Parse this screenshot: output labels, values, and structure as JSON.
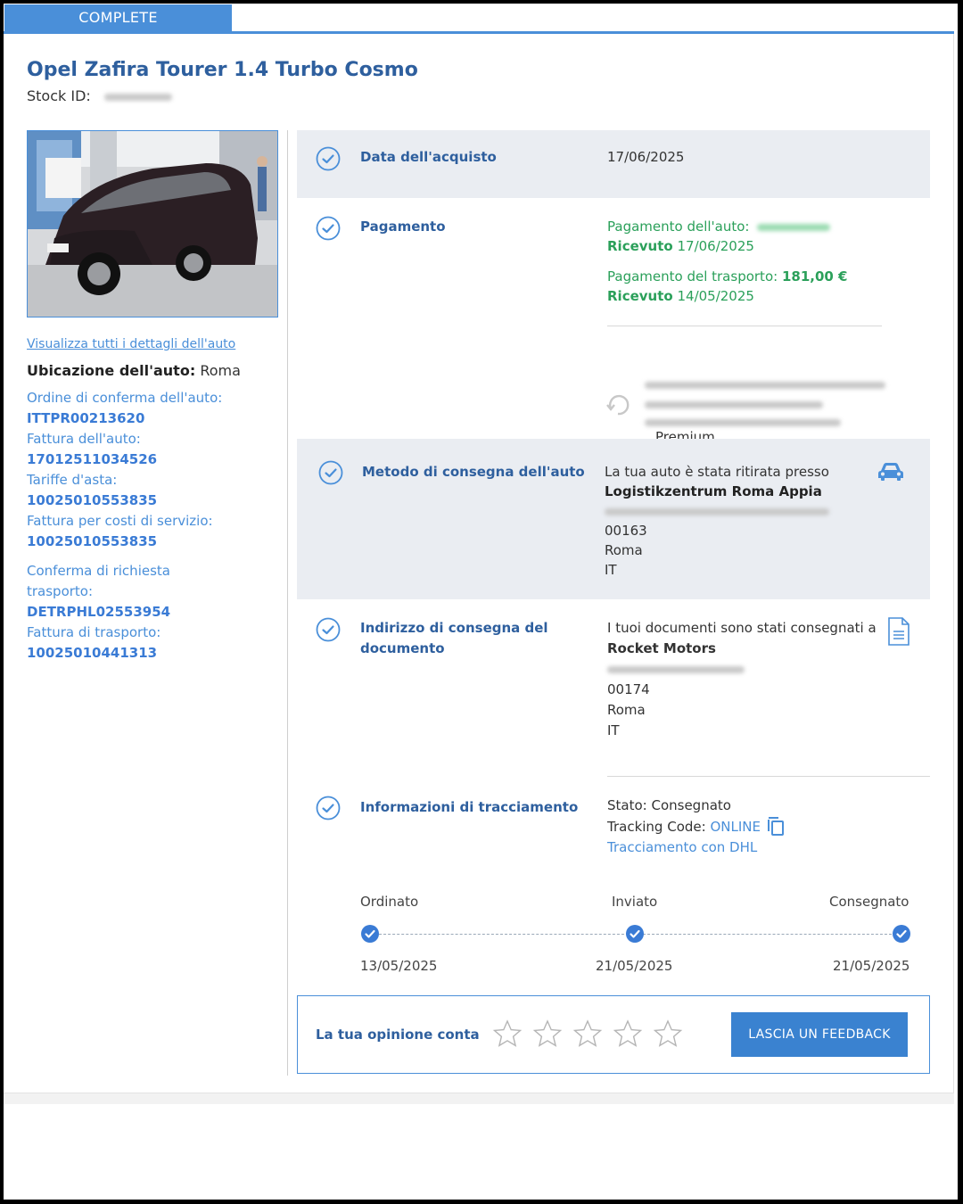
{
  "tabs": {
    "complete": "COMPLETE"
  },
  "vehicle": {
    "title": "Opel Zafira Tourer 1.4 Turbo Cosmo",
    "stock_label": "Stock ID:",
    "details_link": "Visualizza tutti i dettagli dell'auto",
    "location_label": "Ubicazione dell'auto:",
    "location_value": "Roma"
  },
  "references": [
    {
      "label": "Ordine di conferma dell'auto:",
      "value": "ITTPR00213620"
    },
    {
      "label": "Fattura dell'auto:",
      "value": "17012511034526"
    },
    {
      "label": "Tariffe d'asta:",
      "value": "10025010553835"
    },
    {
      "label": "Fattura per costi di servizio:",
      "value": "10025010553835"
    },
    {
      "label": "Conferma di richiesta trasporto:",
      "value": "DETRPHL02553954"
    },
    {
      "label": "Fattura di trasporto:",
      "value": "10025010441313"
    }
  ],
  "purchase": {
    "label": "Data dell'acquisto",
    "date": "17/06/2025"
  },
  "payment": {
    "label": "Pagamento",
    "car_payment_label": "Pagamento dell'auto:",
    "car_status": "Ricevuto",
    "car_date": "17/06/2025",
    "transport_payment_label": "Pagamento del trasporto:",
    "transport_amount": "181,00 €",
    "transport_status": "Ricevuto",
    "transport_date": "14/05/2025",
    "premium": "Premium"
  },
  "car_delivery": {
    "label": "Metodo di consegna dell'auto",
    "intro": "La tua auto è stata ritirata presso",
    "place": "Logistikzentrum Roma Appia",
    "zip": "00163",
    "city": "Roma",
    "country": "IT"
  },
  "doc_delivery": {
    "label_line1": "Indirizzo di consegna del",
    "label_line2": "documento",
    "intro": "I tuoi documenti sono stati consegnati a",
    "recipient": "Rocket Motors",
    "zip": "00174",
    "city": "Roma",
    "country": "IT"
  },
  "tracking": {
    "label": "Informazioni di tracciamento",
    "status": "Stato: Consegnato",
    "code_label": "Tracking Code:",
    "code_value": "ONLINE",
    "dhl_link": "Tracciamento con DHL",
    "steps": [
      {
        "name": "Ordinato",
        "date": "13/05/2025"
      },
      {
        "name": "Inviato",
        "date": "21/05/2025"
      },
      {
        "name": "Consegnato",
        "date": "21/05/2025"
      }
    ]
  },
  "feedback": {
    "prompt": "La tua opinione conta",
    "rating": 0,
    "max_rating": 5,
    "button": "LASCIA UN FEEDBACK"
  },
  "colors": {
    "accent": "#4a8fd9",
    "title": "#2e5f9e",
    "success": "#2ba05a",
    "section_bg": "#eaedf2"
  }
}
